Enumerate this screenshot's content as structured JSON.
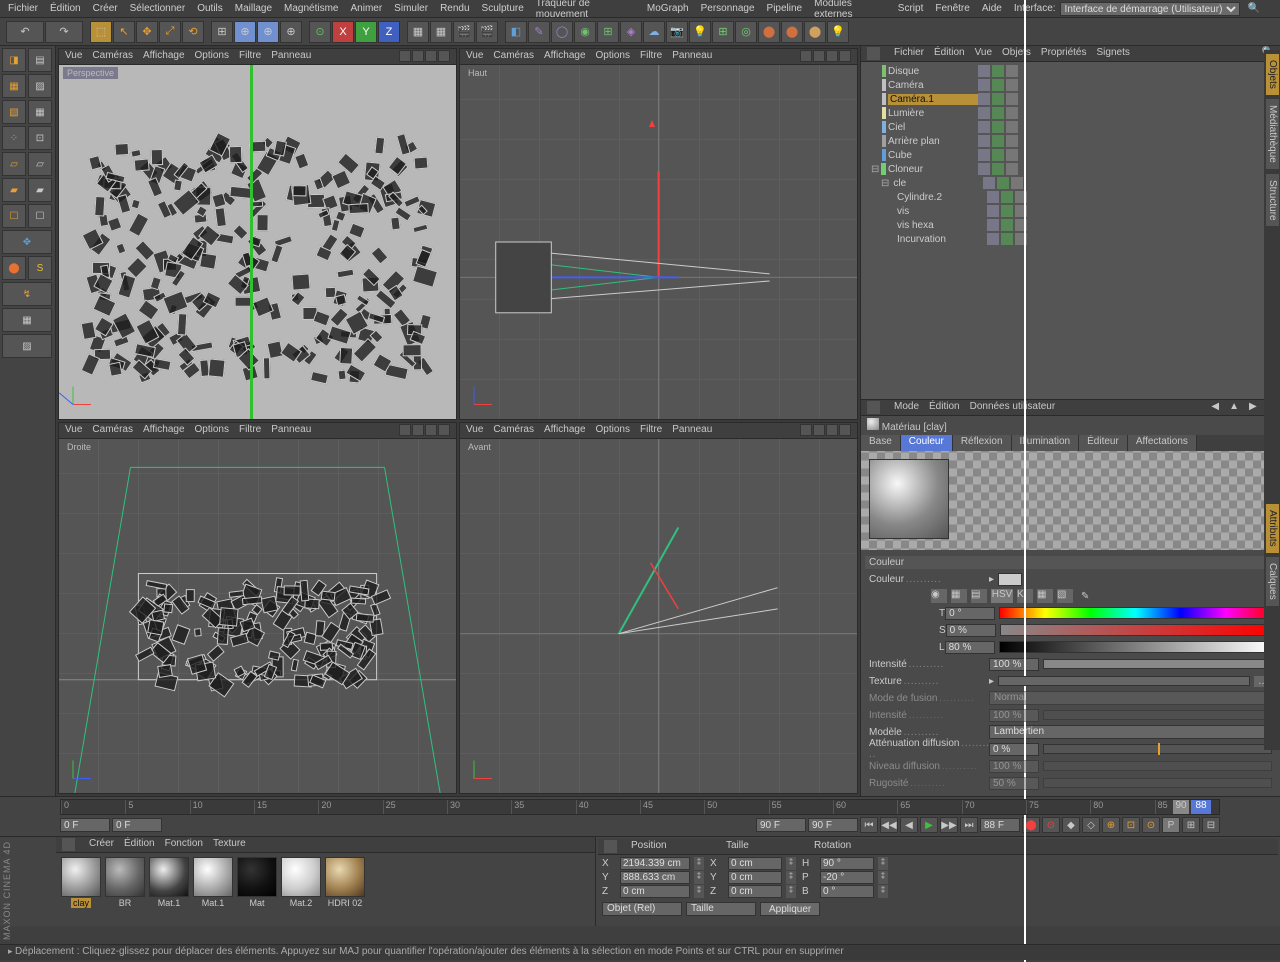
{
  "interface": {
    "label": "Interface:",
    "value": "Interface de démarrage (Utilisateur)"
  },
  "menubar": [
    "Fichier",
    "Édition",
    "Créer",
    "Sélectionner",
    "Outils",
    "Maillage",
    "Magnétisme",
    "Animer",
    "Simuler",
    "Rendu",
    "Sculpture",
    "Traqueur de mouvement",
    "MoGraph",
    "Personnage",
    "Pipeline",
    "Modules externes",
    "Script",
    "Fenêtre",
    "Aide"
  ],
  "viewports": {
    "menu": [
      "Vue",
      "Caméras",
      "Affichage",
      "Options",
      "Filtre",
      "Panneau"
    ],
    "labels": {
      "tl": "Perspective",
      "tr": "Haut",
      "bl": "Droite",
      "br": "Avant"
    }
  },
  "timeline": {
    "ticks": [
      "0",
      "5",
      "10",
      "15",
      "20",
      "25",
      "30",
      "35",
      "40",
      "45",
      "50",
      "55",
      "60",
      "65",
      "70",
      "75",
      "80",
      "85"
    ],
    "current": "88",
    "end": "90",
    "f1": "0 F",
    "f2": "0 F",
    "f3": "90 F",
    "f4": "90 F",
    "rate": "88 F"
  },
  "objects": {
    "menu": [
      "Fichier",
      "Édition",
      "Vue",
      "Objets",
      "Propriétés",
      "Signets"
    ],
    "tree": [
      {
        "name": "Disque",
        "ind": 14,
        "ic": "#7ec16e",
        "exp": ""
      },
      {
        "name": "Caméra",
        "ind": 14,
        "ic": "#c0c0c0",
        "exp": ""
      },
      {
        "name": "Caméra.1",
        "ind": 14,
        "ic": "#c0c0c0",
        "sel": true,
        "exp": ""
      },
      {
        "name": "Lumière",
        "ind": 14,
        "ic": "#e0e0a0",
        "exp": ""
      },
      {
        "name": "Ciel",
        "ind": 14,
        "ic": "#80b0e0",
        "exp": ""
      },
      {
        "name": "Arrière plan",
        "ind": 14,
        "ic": "#a0a0a0",
        "exp": ""
      },
      {
        "name": "Cube",
        "ind": 14,
        "ic": "#60a0d8",
        "exp": ""
      },
      {
        "name": "Cloneur",
        "ind": 8,
        "ic": "#70d070",
        "exp": "⊟"
      },
      {
        "name": "cle",
        "ind": 18,
        "ic": "#c0c0c0",
        "exp": "⊟"
      },
      {
        "name": "Cylindre.2",
        "ind": 30,
        "ic": "#60a0d8",
        "exp": ""
      },
      {
        "name": "vis",
        "ind": 30,
        "ic": "#60a0d8",
        "exp": ""
      },
      {
        "name": "vis hexa",
        "ind": 30,
        "ic": "#60a0d8",
        "exp": ""
      },
      {
        "name": "Incurvation",
        "ind": 30,
        "ic": "#b080d0",
        "exp": ""
      }
    ]
  },
  "attributes": {
    "menu": [
      "Mode",
      "Édition",
      "Données utilisateur"
    ],
    "title": "Matériau [clay]",
    "tabs": [
      "Base",
      "Couleur",
      "Réflexion",
      "Illumination",
      "Éditeur",
      "Affectations"
    ],
    "activeTab": "Couleur",
    "section": "Couleur",
    "couleur": "Couleur",
    "t": {
      "lbl": "T",
      "val": "0 °"
    },
    "s": {
      "lbl": "S",
      "val": "0 %"
    },
    "l": {
      "lbl": "L",
      "val": "80 %"
    },
    "intensite": {
      "lbl": "Intensité",
      "val": "100 %"
    },
    "texture": "Texture",
    "modeFusion": {
      "lbl": "Mode de fusion",
      "val": "Normal"
    },
    "intensite2": {
      "lbl": "Intensité",
      "val": "100 %"
    },
    "modele": {
      "lbl": "Modèle",
      "val": "Lambertien"
    },
    "atten": {
      "lbl": "Atténuation diffusion",
      "val": "0 %"
    },
    "niveau": {
      "lbl": "Niveau diffusion",
      "val": "100 %"
    },
    "rugosite": {
      "lbl": "Rugosité",
      "val": "50 %"
    }
  },
  "materials": {
    "menu": [
      "Créer",
      "Édition",
      "Fonction",
      "Texture"
    ],
    "items": [
      {
        "name": "clay",
        "sel": true,
        "bg": "radial-gradient(circle at 35% 30%,#f0f0f0,#999 55%,#555)"
      },
      {
        "name": "BR",
        "bg": "radial-gradient(circle at 35% 30%,#bbb,#666 55%,#333)"
      },
      {
        "name": "Mat.1",
        "bg": "radial-gradient(circle at 35% 30%,#eee,#444 60%,#111)"
      },
      {
        "name": "Mat.1",
        "bg": "radial-gradient(circle at 35% 30%,#fff,#aaa 55%,#666)"
      },
      {
        "name": "Mat",
        "bg": "radial-gradient(circle at 35% 30%,#333,#111 55%,#000)"
      },
      {
        "name": "Mat.2",
        "bg": "radial-gradient(circle at 35% 30%,#fff,#ccc 55%,#888)"
      },
      {
        "name": "HDRI 02",
        "bg": "radial-gradient(circle at 35% 30%,#e8d8b0,#a08050 55%,#503820)"
      }
    ]
  },
  "coords": {
    "headers": [
      "Position",
      "Taille",
      "Rotation"
    ],
    "rows": [
      {
        "a": "X",
        "av": "2194.339 cm",
        "b": "X",
        "bv": "0 cm",
        "c": "H",
        "cv": "90 °"
      },
      {
        "a": "Y",
        "av": "888.633 cm",
        "b": "Y",
        "bv": "0 cm",
        "c": "P",
        "cv": "-20 °"
      },
      {
        "a": "Z",
        "av": "0 cm",
        "b": "Z",
        "bv": "0 cm",
        "c": "B",
        "cv": "0 °"
      }
    ],
    "drop1": "Objet (Rel)",
    "drop2": "Taille",
    "btn": "Appliquer"
  },
  "status": "Déplacement : Cliquez-glissez pour déplacer des éléments. Appuyez sur MAJ pour quantifier l'opération/ajouter des éléments à la sélection en mode Points et sur CTRL pour en supprimer",
  "brand": "MAXON CINEMA 4D",
  "rtabs": [
    "Objets",
    "Médiathèque",
    "Structure"
  ],
  "rtabs2": [
    "Attributs",
    "Calques"
  ]
}
